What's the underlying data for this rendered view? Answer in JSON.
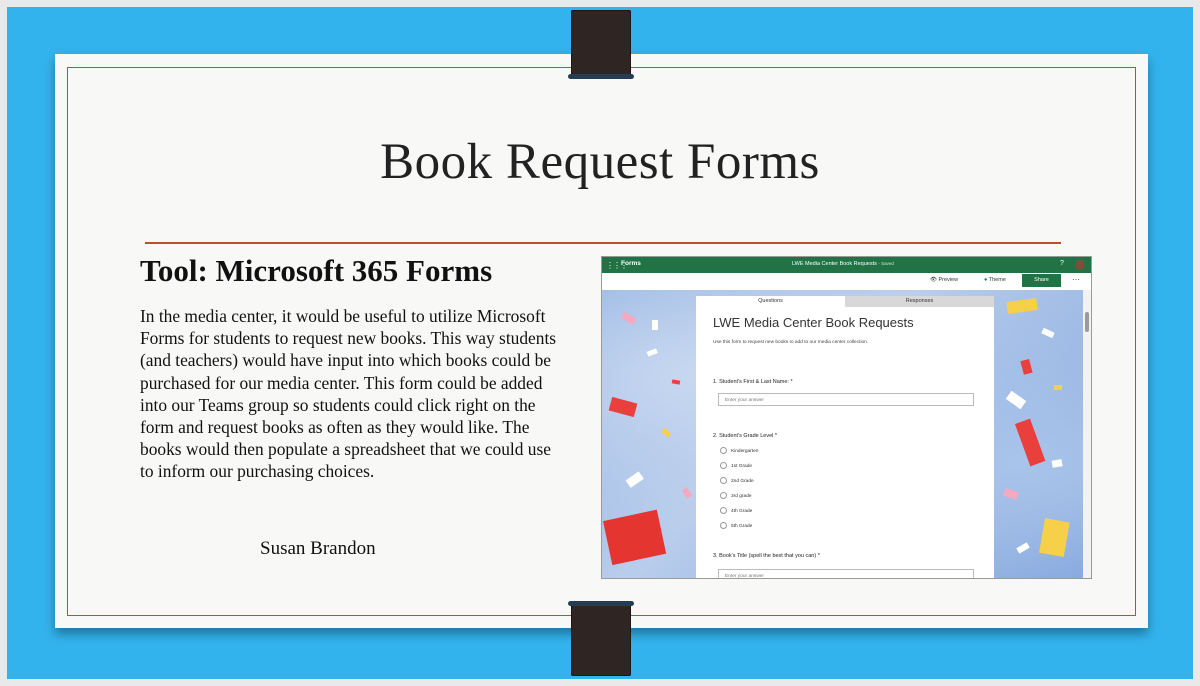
{
  "slide": {
    "title": "Book Request Forms",
    "subtitle": "Tool: Microsoft 365 Forms",
    "body": "In the media center, it would be useful to utilize Microsoft Forms for students to request new books. This way students (and teachers) would have input into which books could be purchased for our media center. This form could be added into our Teams group so students could click right on the form and request books as often as they would like. The books would then populate a spreadsheet that we could use to inform our purchasing choices.",
    "author": "Susan Brandon"
  },
  "forms": {
    "app_name": "Forms",
    "doc_title": "LWE Media Center Book Requests",
    "saved_label": "- Saved",
    "toolbar": {
      "preview": "Preview",
      "theme": "Theme",
      "share": "Share",
      "more": "···"
    },
    "help": "?",
    "tabs": {
      "questions": "Questions",
      "responses": "Responses"
    },
    "form_title": "LWE Media Center Book Requests",
    "description": "Use this form to request new books to add to our media center collection.",
    "questions": [
      {
        "label": "1. Student's First & Last Name: *",
        "placeholder": "Enter your answer"
      },
      {
        "label": "2. Student's Grade Level *",
        "options": [
          "Kindergarten",
          "1st Grade",
          "2nd Grade",
          "3rd grade",
          "4th Grade",
          "5th Grade"
        ]
      },
      {
        "label": "3. Book's Title (spell the best that you can) *",
        "placeholder": "Enter your answer"
      }
    ]
  },
  "colors": {
    "background_blue": "#33b3ee",
    "accent_rust": "#b5532c",
    "forms_green": "#217346"
  }
}
